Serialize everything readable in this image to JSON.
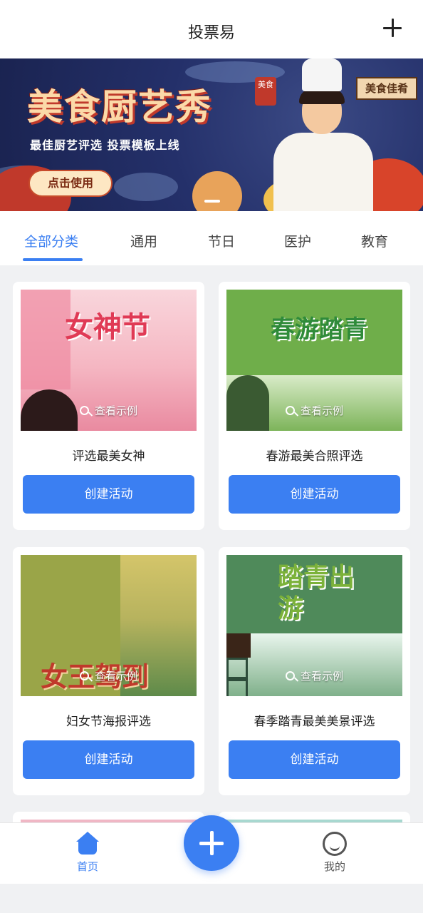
{
  "header": {
    "title": "投票易",
    "add_icon": "plus-icon"
  },
  "banner": {
    "headline": "美食厨艺秀",
    "subtitle": "最佳厨艺评选  投票模板上线",
    "cta": "点击使用",
    "sign": "美食佳肴",
    "seal": "美食"
  },
  "tabs": [
    {
      "label": "全部分类",
      "active": true
    },
    {
      "label": "通用",
      "active": false
    },
    {
      "label": "节日",
      "active": false
    },
    {
      "label": "医护",
      "active": false
    },
    {
      "label": "教育",
      "active": false
    }
  ],
  "cards": [
    {
      "poster_text": "女神节",
      "name": "评选最美女神",
      "example": "查看示例",
      "button": "创建活动"
    },
    {
      "poster_text": "春游踏青",
      "name": "春游最美合照评选",
      "example": "查看示例",
      "button": "创建活动"
    },
    {
      "poster_text": "女王驾到",
      "name": "妇女节海报评选",
      "example": "查看示例",
      "button": "创建活动"
    },
    {
      "poster_text": "踏青出游",
      "name": "春季踏青最美美景评选",
      "example": "查看示例",
      "button": "创建活动"
    }
  ],
  "tabbar": {
    "home_label": "首页",
    "me_label": "我的",
    "fab_icon": "plus-icon"
  },
  "colors": {
    "accent": "#3b7ff2",
    "background": "#f0f1f3"
  }
}
